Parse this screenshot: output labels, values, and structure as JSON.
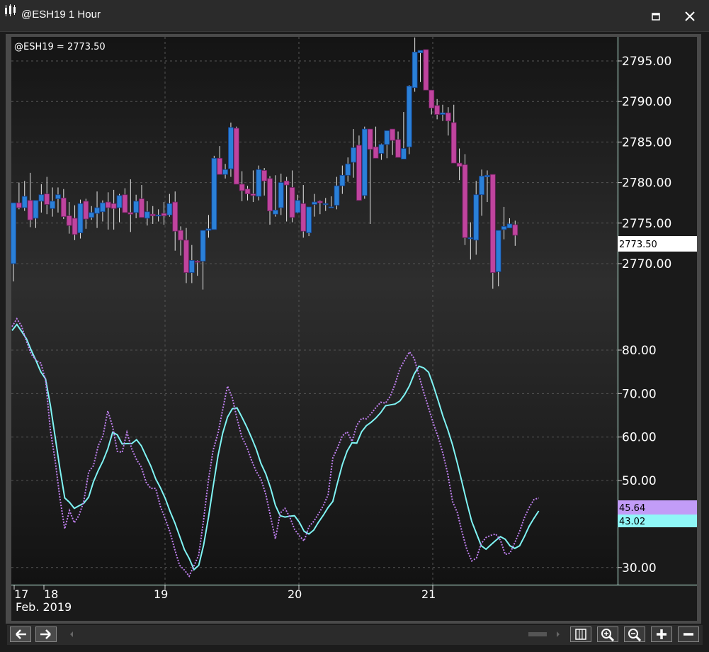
{
  "window": {
    "title": "@ESH19 1 Hour"
  },
  "legend": {
    "symbol_value": "@ESH19 = 2773.50"
  },
  "price_tag": "2773.50",
  "osc_tags": {
    "top": "45.64",
    "bottom": "43.02"
  },
  "date_labels": {
    "d17": "17",
    "d18": "18",
    "d19": "19",
    "d20": "20",
    "d21": "21",
    "month": "Feb. 2019"
  },
  "colors": {
    "up": "#2a80d8",
    "down": "#c0449e",
    "osc_solid": "#7ff4f4",
    "osc_dotted": "#c080f0",
    "tag_top": "#c29cf7",
    "tag_bottom": "#8ff7f7"
  },
  "icons": [
    "app-icon",
    "maximize-icon",
    "close-icon",
    "arrow-left-icon",
    "arrow-right-icon",
    "columns-icon",
    "zoom-in-icon",
    "zoom-out-icon",
    "plus-icon",
    "minus-icon"
  ],
  "chart_data": [
    {
      "type": "candlestick",
      "title": "@ESH19 = 2773.50",
      "ylim": [
        2765,
        2798
      ],
      "y_ticks": [
        "2795.00",
        "2790.00",
        "2785.00",
        "2780.00",
        "2775.00",
        "2770.00"
      ],
      "x_tick_labels": [
        "17",
        "18",
        "19",
        "20",
        "21"
      ],
      "x_label": "Feb. 2019",
      "grid": true,
      "candles": [
        [
          2770.0,
          2775.0,
          2767.8,
          2777.5
        ],
        [
          2777.5,
          2780.0,
          2776.7,
          2776.9
        ],
        [
          2776.9,
          2780.2,
          2776.5,
          2778.3
        ],
        [
          2777.8,
          2781.2,
          2774.5,
          2775.4
        ],
        [
          2775.6,
          2777.8,
          2774.4,
          2777.8
        ],
        [
          2777.7,
          2779.8,
          2776.3,
          2778.5
        ],
        [
          2778.6,
          2780.7,
          2776.1,
          2777.3
        ],
        [
          2776.8,
          2779.4,
          2775.8,
          2777.7
        ],
        [
          2778.0,
          2779.4,
          2776.3,
          2778.5
        ],
        [
          2778.1,
          2779.2,
          2775.5,
          2775.8
        ],
        [
          2775.9,
          2777.6,
          2773.7,
          2774.7
        ],
        [
          2775.6,
          2777.2,
          2772.9,
          2773.6
        ],
        [
          2773.8,
          2777.9,
          2773.1,
          2777.4
        ],
        [
          2777.7,
          2778.0,
          2774.3,
          2775.5
        ],
        [
          2775.7,
          2777.1,
          2775.4,
          2776.3
        ],
        [
          2776.2,
          2778.9,
          2774.4,
          2776.9
        ],
        [
          2776.4,
          2777.8,
          2775.2,
          2777.5
        ],
        [
          2777.6,
          2778.8,
          2774.2,
          2776.9
        ],
        [
          2777.4,
          2779.1,
          2774.2,
          2776.8
        ],
        [
          2776.9,
          2778.6,
          2775.1,
          2778.4
        ],
        [
          2778.5,
          2779.3,
          2776.4,
          2776.3
        ],
        [
          2776.3,
          2780.4,
          2773.9,
          2776.1
        ],
        [
          2776.3,
          2778.5,
          2775.6,
          2777.7
        ],
        [
          2778.0,
          2779.7,
          2775.9,
          2775.7
        ],
        [
          2775.6,
          2777.7,
          2774.7,
          2776.4
        ],
        [
          2776.1,
          2777.1,
          2774.9,
          2775.9
        ],
        [
          2775.9,
          2776.7,
          2775.2,
          2776.0
        ],
        [
          2776.2,
          2777.6,
          2774.8,
          2775.9
        ],
        [
          2776.0,
          2778.6,
          2775.8,
          2777.4
        ],
        [
          2777.6,
          2778.9,
          2771.6,
          2774.0
        ],
        [
          2774.1,
          2774.6,
          2771.0,
          2772.9
        ],
        [
          2772.9,
          2774.4,
          2767.6,
          2768.9
        ],
        [
          2768.9,
          2772.3,
          2767.6,
          2770.4
        ],
        [
          2770.3,
          2770.4,
          2768.5,
          2770.2
        ],
        [
          2770.3,
          2773.6,
          2766.8,
          2774.1
        ],
        [
          2774.1,
          2776.0,
          2773.2,
          2774.3
        ],
        [
          2774.2,
          2783.3,
          2774.3,
          2783.0
        ],
        [
          2783.0,
          2784.5,
          2781.1,
          2781.0
        ],
        [
          2781.0,
          2782.3,
          2780.5,
          2781.6
        ],
        [
          2781.7,
          2787.4,
          2780.7,
          2786.8
        ],
        [
          2786.7,
          2786.9,
          2780.4,
          2779.8
        ],
        [
          2779.8,
          2781.4,
          2777.7,
          2779.0
        ],
        [
          2779.2,
          2779.6,
          2777.8,
          2778.6
        ],
        [
          2778.6,
          2781.5,
          2777.6,
          2778.4
        ],
        [
          2778.3,
          2782.1,
          2777.8,
          2781.6
        ],
        [
          2781.5,
          2781.8,
          2778.4,
          2780.2
        ],
        [
          2780.5,
          2780.8,
          2774.8,
          2776.5
        ],
        [
          2776.1,
          2780.9,
          2775.8,
          2776.6
        ],
        [
          2776.9,
          2781.1,
          2776.0,
          2780.0
        ],
        [
          2780.2,
          2780.7,
          2775.2,
          2779.7
        ],
        [
          2779.4,
          2781.5,
          2775.1,
          2775.7
        ],
        [
          2776.3,
          2778.5,
          2776.2,
          2777.8
        ],
        [
          2777.4,
          2779.7,
          2773.2,
          2774.0
        ],
        [
          2773.8,
          2776.6,
          2773.4,
          2777.0
        ],
        [
          2777.3,
          2778.6,
          2775.8,
          2777.6
        ],
        [
          2777.7,
          2777.8,
          2776.1,
          2777.5
        ],
        [
          2777.4,
          2778.1,
          2776.5,
          2777.4
        ],
        [
          2777.0,
          2778.3,
          2776.9,
          2777.0
        ],
        [
          2777.2,
          2780.7,
          2776.7,
          2779.6
        ],
        [
          2779.6,
          2782.1,
          2778.6,
          2780.9
        ],
        [
          2780.9,
          2783.1,
          2780.1,
          2782.3
        ],
        [
          2782.5,
          2786.6,
          2780.6,
          2784.3
        ],
        [
          2784.6,
          2785.8,
          2777.8,
          2777.8
        ],
        [
          2778.4,
          2786.9,
          2778.0,
          2786.6
        ],
        [
          2786.6,
          2785.3,
          2774.9,
          2784.1
        ],
        [
          2784.4,
          2786.9,
          2783.5,
          2783.0
        ],
        [
          2783.6,
          2784.8,
          2782.8,
          2784.7
        ],
        [
          2784.7,
          2786.2,
          2783.0,
          2786.4
        ],
        [
          2786.6,
          2786.2,
          2783.4,
          2785.2
        ],
        [
          2785.3,
          2786.3,
          2783.7,
          2783.1
        ],
        [
          2782.9,
          2788.7,
          2783.4,
          2784.2
        ],
        [
          2784.4,
          2792.0,
          2783.5,
          2791.9
        ],
        [
          2791.7,
          2797.9,
          2791.2,
          2796.1
        ],
        [
          2796.0,
          2795.6,
          2792.4,
          2796.3
        ],
        [
          2796.4,
          2796.2,
          2791.7,
          2791.4
        ],
        [
          2791.4,
          2791.4,
          2788.4,
          2789.2
        ],
        [
          2789.5,
          2790.3,
          2787.8,
          2788.4
        ],
        [
          2788.4,
          2789.6,
          2787.6,
          2788.6
        ],
        [
          2788.6,
          2789.3,
          2785.8,
          2787.6
        ],
        [
          2787.4,
          2789.6,
          2786.6,
          2782.4
        ],
        [
          2782.4,
          2784.2,
          2780.3,
          2782.0
        ],
        [
          2782.2,
          2783.5,
          2772.3,
          2773.2
        ],
        [
          2773.2,
          2775.1,
          2770.5,
          2773.2
        ],
        [
          2772.9,
          2780.2,
          2771.1,
          2778.5
        ],
        [
          2778.5,
          2781.6,
          2775.9,
          2780.8
        ],
        [
          2780.7,
          2781.5,
          2777.6,
          2780.9
        ],
        [
          2781.0,
          2780.9,
          2766.9,
          2768.9
        ],
        [
          2769.0,
          2774.1,
          2767.2,
          2774.1
        ],
        [
          2774.2,
          2777.0,
          2773.0,
          2774.6
        ],
        [
          2774.4,
          2775.6,
          2774.4,
          2774.9
        ],
        [
          2774.8,
          2775.3,
          2772.2,
          2773.5
        ]
      ]
    },
    {
      "type": "line",
      "ylim": [
        28,
        83
      ],
      "y_ticks": [
        "80.00",
        "70.00",
        "60.00",
        "50.00",
        "30.00"
      ],
      "grid": true,
      "series": [
        {
          "style": "solid",
          "values": [
            84.5,
            85.9,
            84.3,
            82.6,
            80.0,
            77.6,
            75.0,
            73.4,
            67.3,
            60.1,
            52.7,
            46.0,
            45.0,
            43.6,
            44.2,
            44.8,
            46.2,
            49.7,
            52.3,
            54.5,
            57.3,
            61.1,
            60.5,
            58.4,
            58.5,
            58.5,
            59.4,
            58.0,
            55.6,
            53.3,
            50.4,
            48.3,
            45.9,
            42.9,
            40.3,
            37.2,
            34.1,
            32.1,
            29.5,
            30.5,
            35.1,
            41.4,
            48.6,
            55.6,
            60.9,
            64.6,
            66.5,
            66.7,
            64.6,
            62.4,
            59.9,
            57.2,
            53.9,
            51.5,
            48.3,
            44.3,
            41.9,
            41.6,
            41.8,
            41.9,
            40.4,
            38.3,
            37.7,
            38.6,
            40.4,
            42.0,
            43.8,
            45.2,
            49.6,
            53.7,
            56.8,
            58.7,
            58.6,
            61.2,
            62.6,
            63.4,
            64.4,
            65.6,
            67.2,
            67.4,
            67.6,
            68.3,
            69.8,
            71.8,
            74.5,
            76.3,
            75.9,
            74.9,
            71.8,
            68.4,
            64.8,
            61.7,
            58.2,
            54.0,
            49.5,
            44.9,
            40.6,
            37.8,
            35.0,
            34.2,
            35.2,
            36.2,
            37.1,
            36.5,
            35.0,
            34.4,
            35.0,
            37.1,
            39.5,
            41.3,
            43.0
          ]
        },
        {
          "style": "dotted",
          "values": [
            85.4,
            87.2,
            85.5,
            82.0,
            79.1,
            77.7,
            77.0,
            73.2,
            61.6,
            54.7,
            45.9,
            38.9,
            43.1,
            40.3,
            42.0,
            45.3,
            52.0,
            53.4,
            58.0,
            60.3,
            66.0,
            62.4,
            56.7,
            56.5,
            61.1,
            57.3,
            54.8,
            53.1,
            49.6,
            48.2,
            48.2,
            44.0,
            41.2,
            38.1,
            34.1,
            30.5,
            29.4,
            28.0,
            30.4,
            32.9,
            40.9,
            50.0,
            57.0,
            60.8,
            66.3,
            71.7,
            69.0,
            64.2,
            60.0,
            57.8,
            54.7,
            52.1,
            50.3,
            46.8,
            41.7,
            36.6,
            42.5,
            43.6,
            41.6,
            38.8,
            37.3,
            36.1,
            39.4,
            40.6,
            42.3,
            44.2,
            46.7,
            55.2,
            57.6,
            60.3,
            61.2,
            59.0,
            62.7,
            64.3,
            64.2,
            65.4,
            66.8,
            68.0,
            67.8,
            69.4,
            72.2,
            75.7,
            77.7,
            79.6,
            78.1,
            74.1,
            70.2,
            66.7,
            63.1,
            60.0,
            56.2,
            51.5,
            45.2,
            42.6,
            38.1,
            34.1,
            31.5,
            32.2,
            35.5,
            36.9,
            37.4,
            37.7,
            36.3,
            33.0,
            33.3,
            35.7,
            38.3,
            41.4,
            43.8,
            45.6,
            46.0
          ]
        }
      ]
    }
  ]
}
